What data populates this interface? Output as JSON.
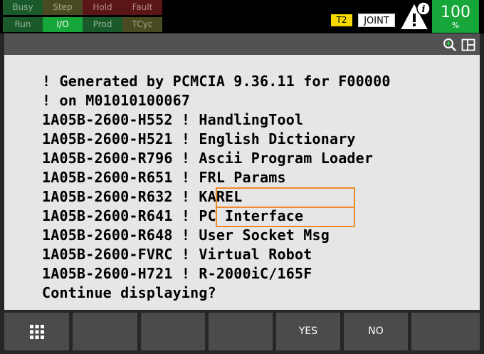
{
  "status_leds": [
    {
      "label": "Busy",
      "state": "off",
      "color": "green"
    },
    {
      "label": "Step",
      "state": "off",
      "color": "yellow"
    },
    {
      "label": "Hold",
      "state": "off",
      "color": "red"
    },
    {
      "label": "Fault",
      "state": "off",
      "color": "red"
    },
    {
      "label": "Run",
      "state": "off",
      "color": "green"
    },
    {
      "label": "I/O",
      "state": "on",
      "color": "green"
    },
    {
      "label": "Prod",
      "state": "off",
      "color": "green"
    },
    {
      "label": "TCyc",
      "state": "off",
      "color": "yellow"
    }
  ],
  "mode_badge": "T2",
  "coord_badge": "JOINT",
  "alert_icon": "warning-info-icon",
  "override": {
    "value": "100",
    "unit": "%"
  },
  "toolbar_icons": [
    "zoom-in-icon",
    "split-window-icon"
  ],
  "screen_lines": [
    "! Generated by PCMCIA 9.36.11 for F00000",
    "! on M01010100067",
    "1A05B-2600-H552 ! HandlingTool",
    "1A05B-2600-H521 ! English Dictionary",
    "1A05B-2600-R796 ! Ascii Program Loader",
    "1A05B-2600-R651 ! FRL Params",
    "1A05B-2600-R632 ! KAREL",
    "1A05B-2600-R641 ! PC Interface",
    "1A05B-2600-R648 ! User Socket Msg",
    "1A05B-2600-FVRC ! Virtual Robot",
    "1A05B-2600-H721 ! R-2000iC/165F",
    "Continue displaying?"
  ],
  "highlighted_options": [
    "KAREL",
    "PC Interface"
  ],
  "function_keys": {
    "f0_icon": "grid-menu-icon",
    "f1": "",
    "f2": "",
    "f3": "",
    "f4": "YES",
    "f5": "NO",
    "f6": ""
  },
  "colors": {
    "led_on": "#17a63a",
    "highlight_box": "#ef8a2a",
    "t2_badge": "#f5d800",
    "screen_bg": "#e6e6e6"
  }
}
